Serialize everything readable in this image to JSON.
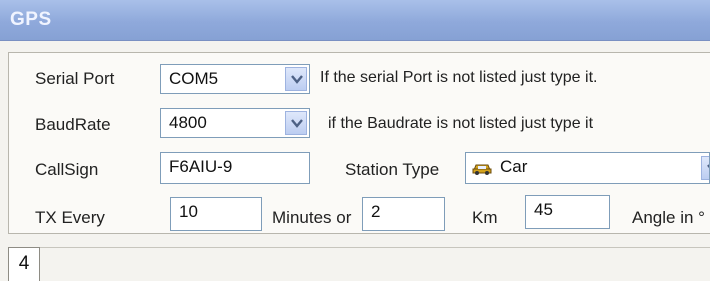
{
  "window": {
    "title": "GPS"
  },
  "serial": {
    "label": "Serial Port",
    "value": "COM5",
    "hint": "If the serial Port is not listed just type it."
  },
  "baud": {
    "label": "BaudRate",
    "value": "4800",
    "hint": "if the Baudrate is not listed just type it"
  },
  "callsign": {
    "label": "CallSign",
    "value": "F6AIU-9"
  },
  "station": {
    "label": "Station Type",
    "value": "Car",
    "icon": "car-icon"
  },
  "tx": {
    "label": "TX Every",
    "minutes_value": "10",
    "minutes_label": "Minutes or",
    "km_value": "2",
    "km_label": "Km",
    "angle_value": "45",
    "angle_label": "Angle in °"
  },
  "bottom": {
    "value": "4"
  },
  "colors": {
    "title_bar": "#8fa9db",
    "field_border": "#7f9db9",
    "car_icon": "#d4a31c"
  }
}
